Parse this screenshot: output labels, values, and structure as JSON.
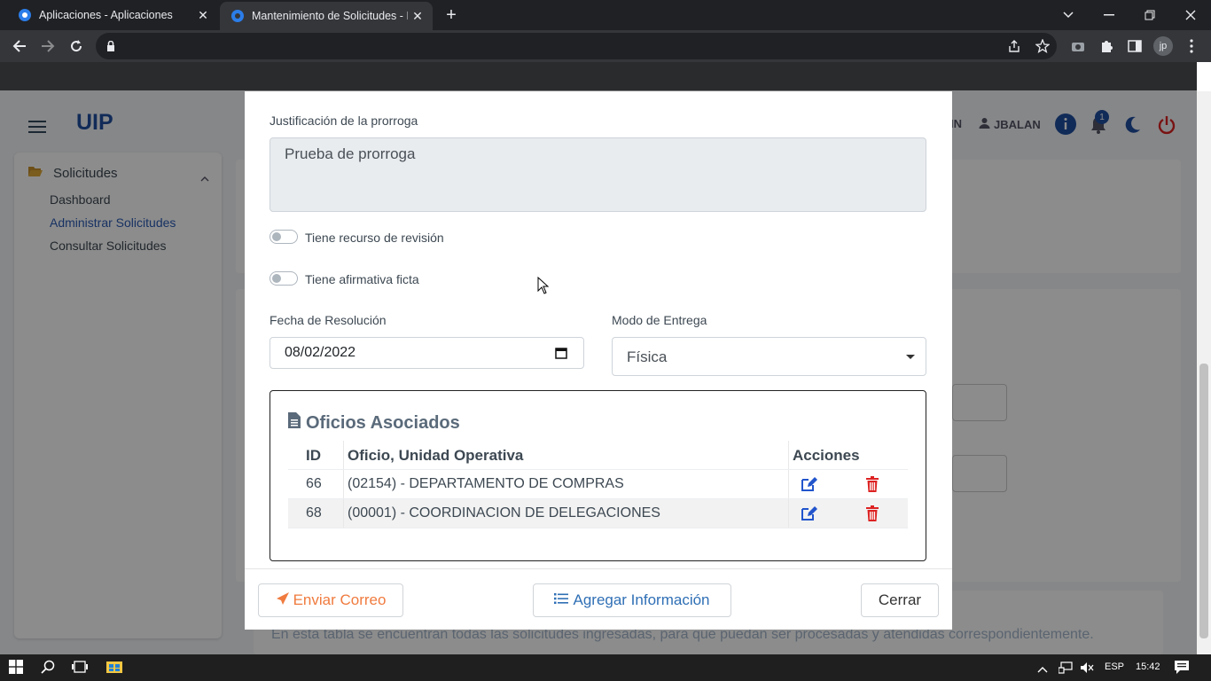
{
  "browser": {
    "tabs": [
      {
        "title": "Aplicaciones - Aplicaciones",
        "close": "✕"
      },
      {
        "title": "Mantenimiento de Solicitudes - In",
        "close": "✕"
      }
    ],
    "new_tab": "+",
    "user_initials": "jp"
  },
  "app": {
    "brand": "UIP",
    "user_left": "IN",
    "user_name": "JBALAN",
    "notification_count": "1"
  },
  "sidebar": {
    "section": "Solicitudes",
    "items": [
      {
        "label": "Dashboard"
      },
      {
        "label": "Administrar Solicitudes"
      },
      {
        "label": "Consultar Solicitudes"
      }
    ]
  },
  "modal": {
    "justificacion_label": "Justificación de la prorroga",
    "justificacion_value": "Prueba de prorroga",
    "toggle_revision": "Tiene recurso de revisión",
    "toggle_afirmativa": "Tiene afirmativa ficta",
    "fecha_label": "Fecha de Resolución",
    "fecha_value": "08/02/2022",
    "modo_label": "Modo de Entrega",
    "modo_value": "Física",
    "oficios": {
      "title": "Oficios Asociados",
      "headers": {
        "id": "ID",
        "oficio": "Oficio, Unidad Operativa",
        "acciones": "Acciones"
      },
      "rows": [
        {
          "id": "66",
          "oficio": "(02154) - DEPARTAMENTO DE COMPRAS"
        },
        {
          "id": "68",
          "oficio": "(00001) - COORDINACION DE DELEGACIONES"
        }
      ]
    },
    "buttons": {
      "enviar": "Enviar Correo",
      "agregar": "Agregar Información",
      "cerrar": "Cerrar"
    }
  },
  "behind_text": "En esta tabla se encuentran todas las solicitudes ingresadas, para que puedan ser procesadas y atendidas correspondientemente.",
  "taskbar": {
    "lang": "ESP",
    "time": "15:42"
  },
  "colors": {
    "brand": "#1f4fa0",
    "edit_icon": "#2255cc",
    "delete_icon": "#dd2222",
    "mail_button": "#f07b3f",
    "info_button": "#2f6fb5"
  }
}
